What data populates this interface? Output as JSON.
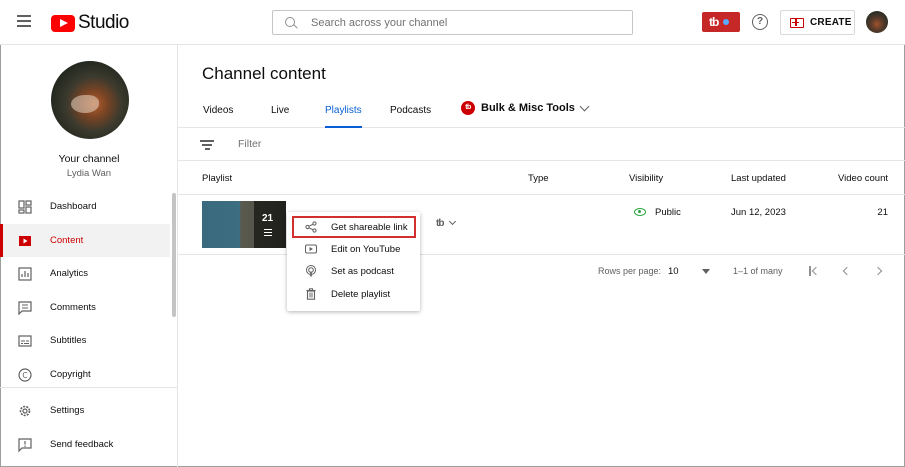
{
  "header": {
    "logo_text": "Studio",
    "search_placeholder": "Search across your channel",
    "create_label": "CREATE",
    "help_glyph": "?",
    "tb_glyph": "tb"
  },
  "sidebar": {
    "channel_label": "Your channel",
    "channel_user": "Lydia Wan",
    "items": [
      {
        "label": "Dashboard",
        "icon": "dashboard-icon",
        "active": false
      },
      {
        "label": "Content",
        "icon": "content-icon",
        "active": true
      },
      {
        "label": "Analytics",
        "icon": "analytics-icon",
        "active": false
      },
      {
        "label": "Comments",
        "icon": "comments-icon",
        "active": false
      },
      {
        "label": "Subtitles",
        "icon": "subtitles-icon",
        "active": false
      },
      {
        "label": "Copyright",
        "icon": "copyright-icon",
        "active": false
      },
      {
        "label": "Settings",
        "icon": "settings-icon",
        "active": false
      },
      {
        "label": "Send feedback",
        "icon": "feedback-icon",
        "active": false
      }
    ]
  },
  "main": {
    "title": "Channel content",
    "tabs": [
      "Videos",
      "Live",
      "Playlists",
      "Podcasts"
    ],
    "active_tab": "Playlists",
    "tools_label": "Bulk & Misc Tools",
    "filter_label": "Filter",
    "columns": [
      "Playlist",
      "Type",
      "Visibility",
      "Last updated",
      "Video count"
    ],
    "rows": [
      {
        "thumbnail_count": "21",
        "type": "",
        "visibility": "Public",
        "last_updated": "Jun 12, 2023",
        "video_count": "21"
      }
    ],
    "pager": {
      "rows_per_page_label": "Rows per page:",
      "rows_per_page": "10",
      "range": "1–1 of many"
    }
  },
  "menu": {
    "items": [
      {
        "label": "Get shareable link",
        "icon": "share-icon"
      },
      {
        "label": "Edit on YouTube",
        "icon": "youtube-icon"
      },
      {
        "label": "Set as podcast",
        "icon": "podcast-icon"
      },
      {
        "label": "Delete playlist",
        "icon": "trash-icon"
      }
    ]
  },
  "colors": {
    "accent": "#065fd4",
    "brand_red": "#ff0000",
    "active_red": "#cc0000",
    "public_green": "#2ba640"
  }
}
